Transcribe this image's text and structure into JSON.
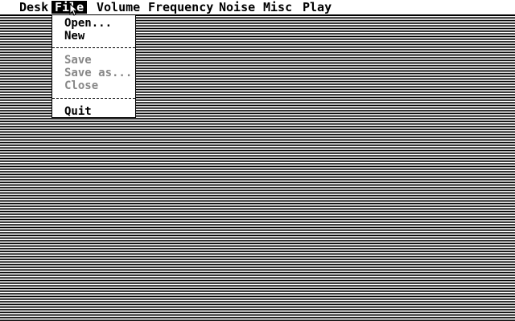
{
  "menubar": {
    "items": [
      {
        "label": "Desk"
      },
      {
        "label": "File",
        "active": true
      },
      {
        "label": "Volume"
      },
      {
        "label": "Frequency"
      },
      {
        "label": "Noise"
      },
      {
        "label": "Misc"
      },
      {
        "label": "Play"
      }
    ]
  },
  "file_menu": {
    "items": [
      {
        "label": "Open...",
        "enabled": true
      },
      {
        "label": "New",
        "enabled": true
      },
      {
        "label": "Save",
        "enabled": false
      },
      {
        "label": "Save as...",
        "enabled": false
      },
      {
        "label": "Close",
        "enabled": false
      },
      {
        "label": "Quit",
        "enabled": true
      }
    ]
  },
  "icons": {
    "pointer": "arrow-pointer-icon"
  },
  "colors": {
    "foreground": "#000000",
    "background": "#ffffff",
    "disabled_text": "#888888"
  }
}
